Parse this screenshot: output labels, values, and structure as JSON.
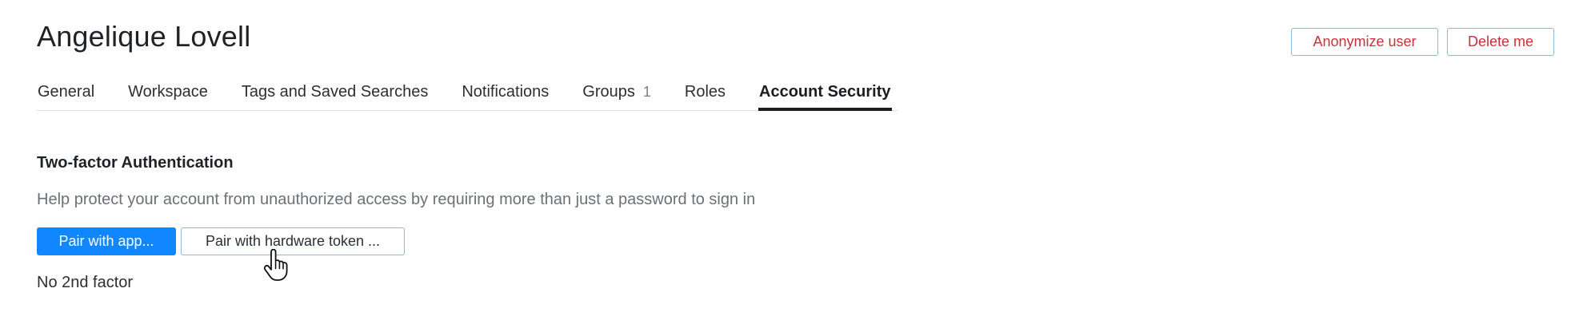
{
  "user": {
    "name": "Angelique Lovell"
  },
  "header_actions": {
    "anonymize_label": "Anonymize user",
    "delete_label": "Delete me"
  },
  "tabs": [
    {
      "label": "General",
      "active": false
    },
    {
      "label": "Workspace",
      "active": false
    },
    {
      "label": "Tags and Saved Searches",
      "active": false
    },
    {
      "label": "Notifications",
      "active": false
    },
    {
      "label": "Groups",
      "count": "1",
      "active": false
    },
    {
      "label": "Roles",
      "active": false
    },
    {
      "label": "Account Security",
      "active": true
    }
  ],
  "two_factor": {
    "title": "Two-factor Authentication",
    "description": "Help protect your account from unauthorized access by requiring more than just a password to sign in",
    "pair_app_label": "Pair with app...",
    "pair_token_label": "Pair with hardware token ...",
    "status": "No 2nd factor"
  },
  "colors": {
    "primary": "#1187ff",
    "danger": "#c8323a",
    "outline_border": "#8ab8e6",
    "muted_text": "#6b7177"
  },
  "icons": {
    "cursor": "hand-pointer-icon"
  }
}
